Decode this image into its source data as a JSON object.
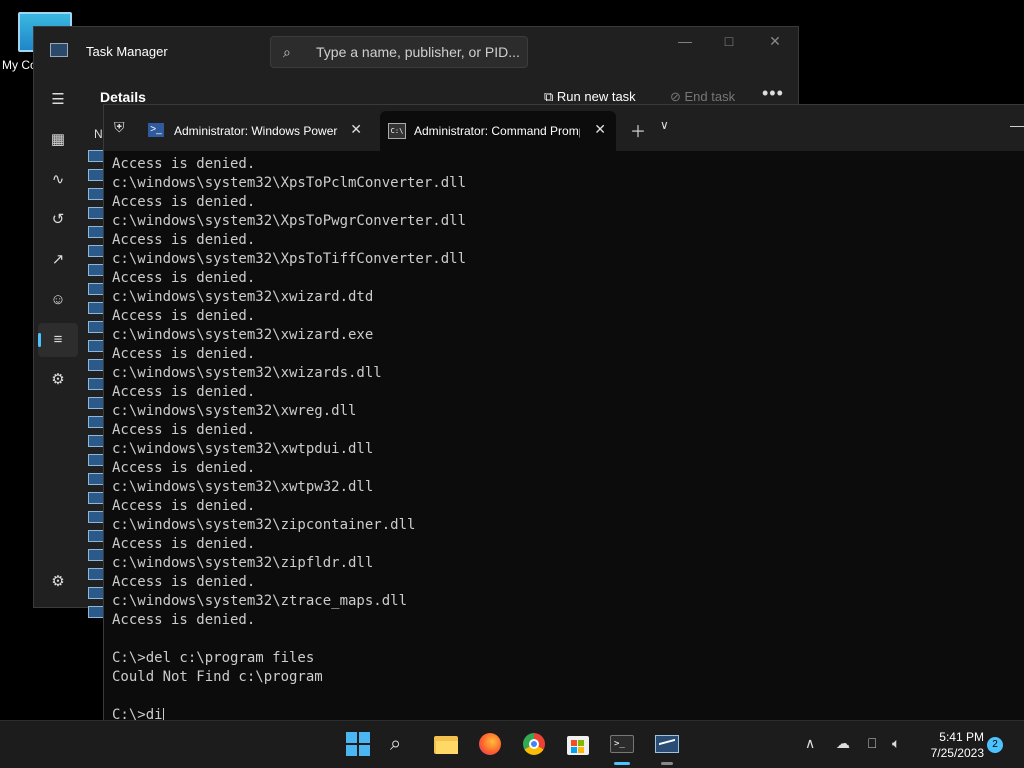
{
  "desktop": {
    "icon_label": "My Co"
  },
  "task_manager": {
    "title": "Task Manager",
    "search_placeholder": "Type a name, publisher, or PID...",
    "page_heading": "Details",
    "run_new_task": "Run new task",
    "end_task": "End task",
    "column_header": "N",
    "nav": [
      "processes-icon",
      "performance-icon",
      "app-history-icon",
      "startup-apps-icon",
      "users-icon",
      "details-icon",
      "services-icon",
      "settings-icon"
    ]
  },
  "terminal": {
    "tabs": [
      {
        "label": "Administrator: Windows PowerShell",
        "icon": "powershell-icon"
      },
      {
        "label": "Administrator: Command Prompt",
        "icon": "cmd-icon"
      }
    ],
    "lines": [
      "Access is denied.",
      "c:\\windows\\system32\\XpsToPclmConverter.dll",
      "Access is denied.",
      "c:\\windows\\system32\\XpsToPwgrConverter.dll",
      "Access is denied.",
      "c:\\windows\\system32\\XpsToTiffConverter.dll",
      "Access is denied.",
      "c:\\windows\\system32\\xwizard.dtd",
      "Access is denied.",
      "c:\\windows\\system32\\xwizard.exe",
      "Access is denied.",
      "c:\\windows\\system32\\xwizards.dll",
      "Access is denied.",
      "c:\\windows\\system32\\xwreg.dll",
      "Access is denied.",
      "c:\\windows\\system32\\xwtpdui.dll",
      "Access is denied.",
      "c:\\windows\\system32\\xwtpw32.dll",
      "Access is denied.",
      "c:\\windows\\system32\\zipcontainer.dll",
      "Access is denied.",
      "c:\\windows\\system32\\zipfldr.dll",
      "Access is denied.",
      "c:\\windows\\system32\\ztrace_maps.dll",
      "Access is denied.",
      "",
      "C:\\>del c:\\program files",
      "Could Not Find c:\\program",
      ""
    ],
    "prompt": "C:\\>di"
  },
  "taskbar": {
    "time": "5:41 PM",
    "date": "7/25/2023",
    "notification_count": "2",
    "accent": "#4cc2ff"
  }
}
